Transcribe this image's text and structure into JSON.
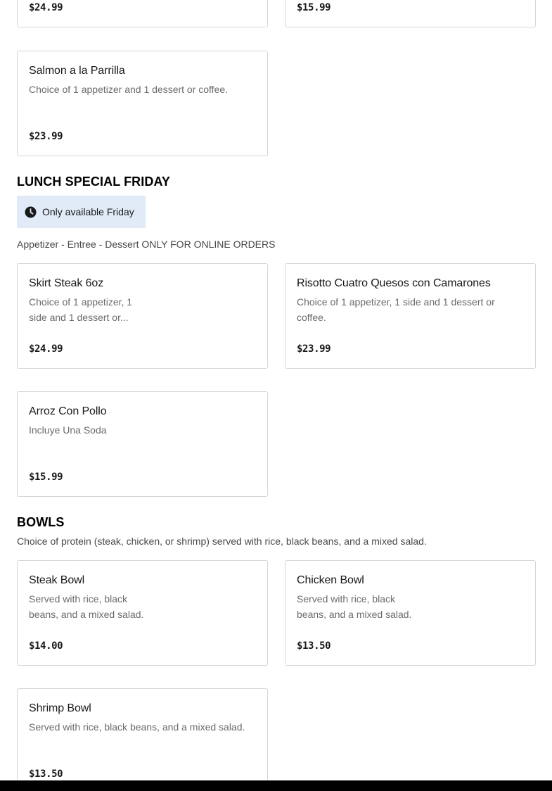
{
  "top_cards": [
    {
      "price": "$24.99"
    },
    {
      "price": "$15.99"
    }
  ],
  "prev_section_cards": [
    {
      "name": "Salmon a la Parrilla",
      "description": "Choice of 1 appetizer and 1 dessert or coffee.",
      "price": "$23.99"
    }
  ],
  "lunch_special": {
    "title": "LUNCH SPECIAL FRIDAY",
    "availability": "Only available Friday",
    "description": "Appetizer - Entree - Dessert ONLY FOR ONLINE ORDERS",
    "items": [
      {
        "name": "Skirt Steak 6oz",
        "description": "Choice of 1 appetizer, 1 side and 1 dessert or...",
        "price": "$24.99"
      },
      {
        "name": "Risotto Cuatro Quesos con Camarones",
        "description": "Choice of 1 appetizer, 1 side and 1 dessert or coffee.",
        "price": "$23.99"
      },
      {
        "name": "Arroz Con Pollo",
        "description": "Incluye Una Soda",
        "price": "$15.99"
      }
    ]
  },
  "bowls": {
    "title": "BOWLS",
    "description": "Choice of protein (steak, chicken, or shrimp) served with rice, black beans, and a mixed salad.",
    "items": [
      {
        "name": "Steak Bowl",
        "description": "Served with rice, black beans, and a mixed salad.",
        "price": "$14.00"
      },
      {
        "name": "Chicken Bowl",
        "description": "Served with rice, black beans, and a mixed salad.",
        "price": "$13.50"
      },
      {
        "name": "Shrimp Bowl",
        "description": "Served with rice, black beans, and a mixed salad.",
        "price": "$13.50"
      }
    ]
  },
  "icons": {
    "availability": "clock-icon"
  }
}
